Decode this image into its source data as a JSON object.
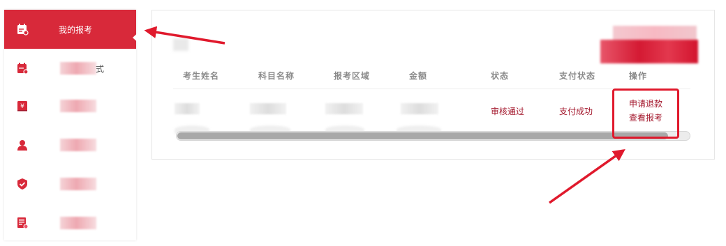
{
  "sidebar": {
    "items": [
      {
        "label": "我的报考",
        "icon": "calendar-icon",
        "active": true
      },
      {
        "label": "",
        "tail": "式",
        "icon": "calendar-check-icon"
      },
      {
        "label": "",
        "icon": "money-icon"
      },
      {
        "label": "",
        "icon": "user-icon"
      },
      {
        "label": "",
        "icon": "shield-check-icon"
      },
      {
        "label": "",
        "icon": "document-icon"
      }
    ]
  },
  "table": {
    "headers": [
      "考生姓名",
      "科目名称",
      "报考区域",
      "金额",
      "状态",
      "支付状态",
      "操作"
    ],
    "rows": [
      {
        "status": "审核通过",
        "payment_status": "支付成功",
        "actions": [
          "申请退款",
          "查看报考"
        ]
      }
    ]
  },
  "colors": {
    "accent": "#d8293a",
    "annotation": "#e0192c",
    "link": "#a3162b"
  }
}
